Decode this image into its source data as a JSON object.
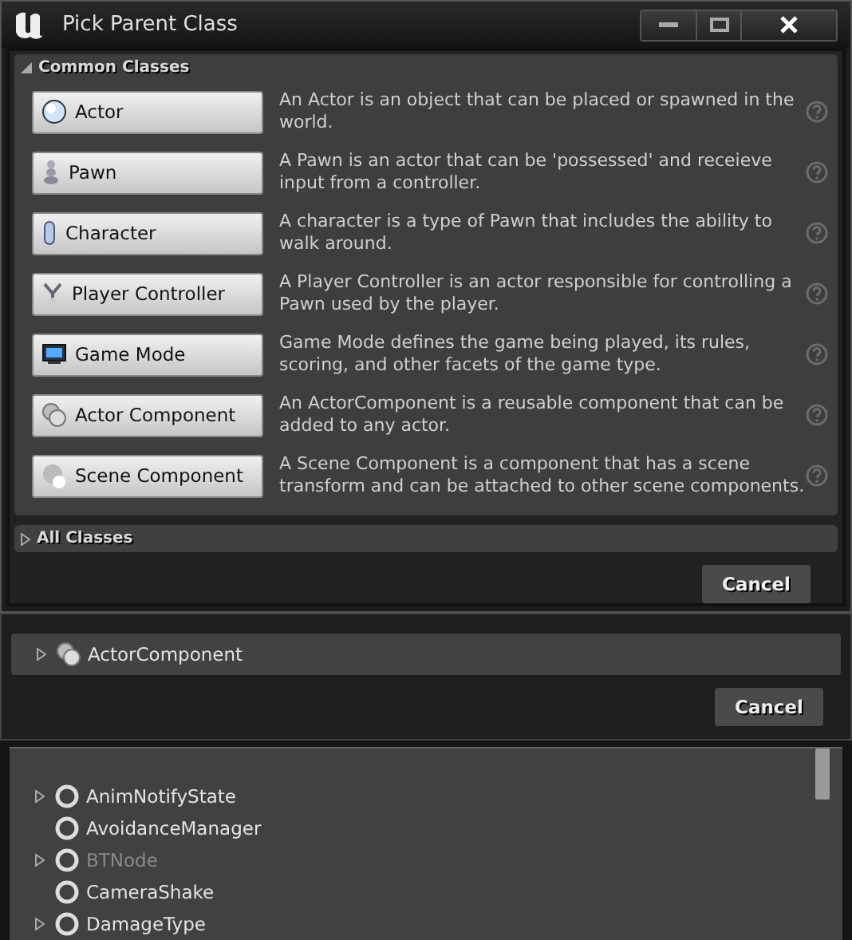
{
  "window": {
    "title": "Pick Parent Class"
  },
  "common_classes": {
    "header": "Common Classes",
    "expanded": true,
    "items": [
      {
        "label": "Actor",
        "description": "An Actor is an object that can be placed or spawned in the world."
      },
      {
        "label": "Pawn",
        "description": "A Pawn is an actor that can be 'possessed' and receieve input from a controller."
      },
      {
        "label": "Character",
        "description": "A character is a type of Pawn that includes the ability to walk around."
      },
      {
        "label": "Player Controller",
        "description": "A Player Controller is an actor responsible for controlling a Pawn used by the player."
      },
      {
        "label": "Game Mode",
        "description": "Game Mode defines the game being played, its rules, scoring, and other facets of the game type."
      },
      {
        "label": "Actor Component",
        "description": "An ActorComponent is a reusable component that can be added to any actor."
      },
      {
        "label": "Scene Component",
        "description": "A Scene Component is a component that has a scene transform and can be attached to other scene components."
      }
    ]
  },
  "all_classes": {
    "header": "All Classes",
    "expanded": false
  },
  "cancel_button": "Cancel",
  "expanded_view": {
    "tree": [
      {
        "label": "ActorComponent",
        "expandable": true,
        "disabled": false
      }
    ],
    "cancel_button": "Cancel"
  },
  "class_list": [
    {
      "label": "AnimNotifyState",
      "expandable": true,
      "disabled": false
    },
    {
      "label": "AvoidanceManager",
      "expandable": false,
      "disabled": false
    },
    {
      "label": "BTNode",
      "expandable": true,
      "disabled": true
    },
    {
      "label": "CameraShake",
      "expandable": false,
      "disabled": false
    },
    {
      "label": "DamageType",
      "expandable": true,
      "disabled": false
    }
  ]
}
